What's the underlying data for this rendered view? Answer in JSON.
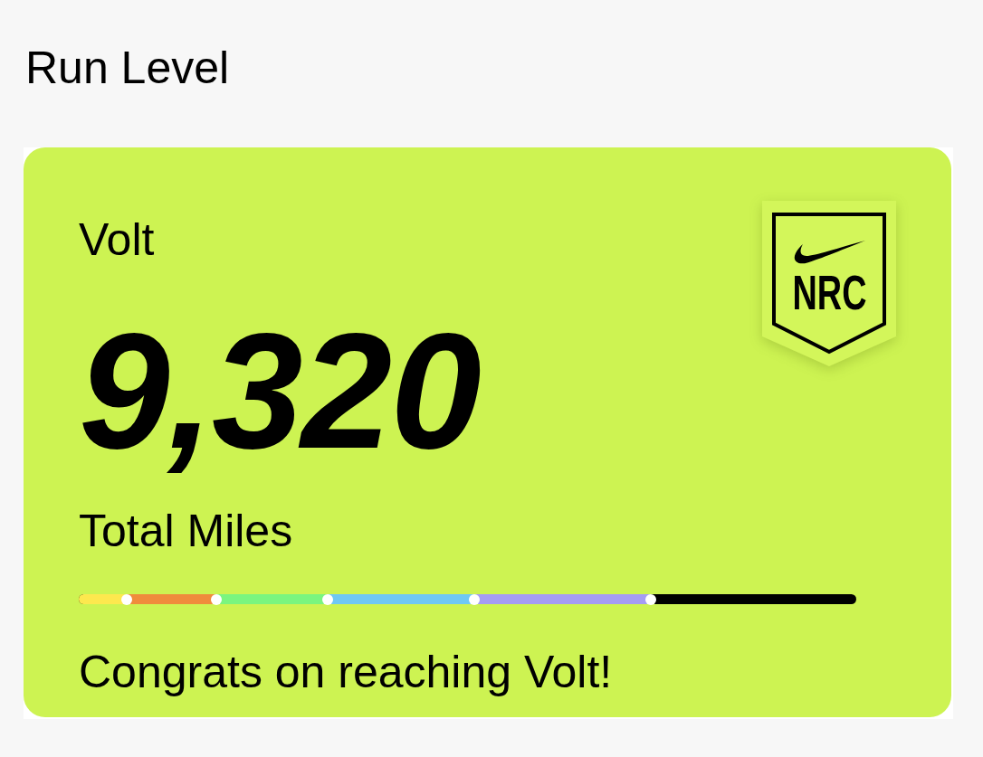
{
  "title": "Run Level",
  "card": {
    "level_name": "Volt",
    "total": "9,320",
    "total_label": "Total Miles",
    "logo": {
      "text": "NRC"
    },
    "progress": {
      "segments": [
        {
          "color": "#fde84e"
        },
        {
          "color": "#f08c3c"
        },
        {
          "color": "#7af57f"
        },
        {
          "color": "#6fc8f4"
        },
        {
          "color": "#a59cf4"
        },
        {
          "color": "#000000"
        }
      ],
      "milestones": [
        {
          "level": 0.062
        },
        {
          "level": 0.177
        },
        {
          "level": 0.32
        },
        {
          "level": 0.509
        },
        {
          "level": 0.736
        }
      ]
    },
    "message": "Congrats on reaching Volt!"
  }
}
